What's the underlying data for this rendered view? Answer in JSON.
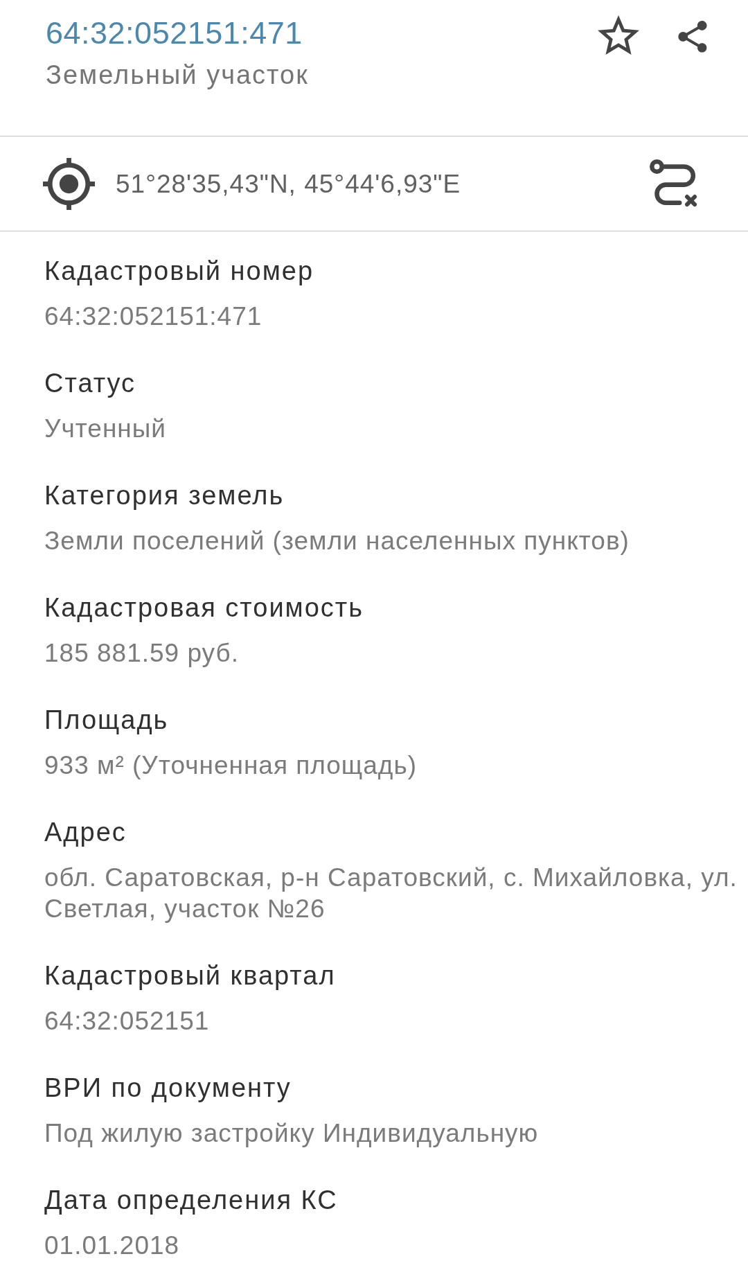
{
  "header": {
    "title": "64:32:052151:471",
    "subtitle": "Земельный участок",
    "starred": false
  },
  "location": {
    "coordinates": "51°28'35,43\"N, 45°44'6,93\"E"
  },
  "fields": [
    {
      "label": "Кадастровый номер",
      "value": "64:32:052151:471"
    },
    {
      "label": "Статус",
      "value": "Учтенный"
    },
    {
      "label": "Категория земель",
      "value": "Земли поселений (земли населенных пунктов)"
    },
    {
      "label": "Кадастровая стоимость",
      "value": "185 881.59 руб."
    },
    {
      "label": "Площадь",
      "value": "933 м² (Уточненная площадь)"
    },
    {
      "label": "Адрес",
      "value": "обл. Саратовская, р-н Саратовский, с. Михайловка, ул. Светлая, участок №26"
    },
    {
      "label": "Кадастровый квартал",
      "value": "64:32:052151"
    },
    {
      "label": "ВРИ по документу",
      "value": "Под жилую застройку Индивидуальную"
    },
    {
      "label": "Дата определения КС",
      "value": "01.01.2018"
    }
  ]
}
